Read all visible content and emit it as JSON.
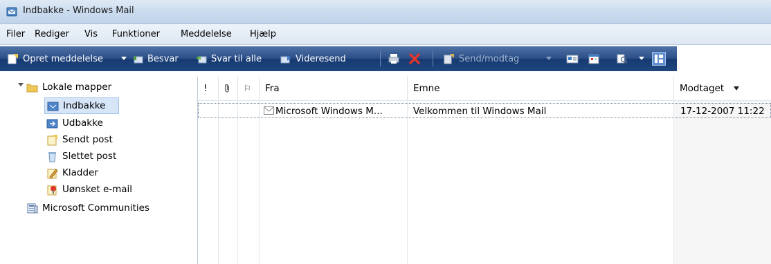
{
  "window": {
    "title": "Indbakke - Windows Mail",
    "icon": "windows-mail-app-icon"
  },
  "menu": [
    "Filer",
    "Rediger",
    "Vis",
    "Funktioner",
    "Meddelelse",
    "Hjælp"
  ],
  "toolbar": {
    "create": "Opret meddelelse",
    "reply": "Besvar",
    "reply_all": "Svar til alle",
    "forward": "Videresend",
    "send_receive": "Send/modtag"
  },
  "folders": {
    "root": "Lokale mapper",
    "items": [
      "Indbakke",
      "Udbakke",
      "Sendt post",
      "Slettet post",
      "Kladder",
      "Uønsket e-mail"
    ],
    "communities": "Microsoft Communities"
  },
  "columns": {
    "priority": "!",
    "attachment": "⁠📎",
    "flag": "⚐",
    "from": "Fra",
    "subject": "Emne",
    "received": "Modtaget"
  },
  "messages": [
    {
      "from": "Microsoft Windows M...",
      "subject": "Velkommen til Windows Mail",
      "received": "17-12-2007 11:22"
    }
  ],
  "colors": {
    "toolbar": "#1f467f",
    "selection": "#d6e6f8",
    "title_bar": "#cbdcef"
  }
}
